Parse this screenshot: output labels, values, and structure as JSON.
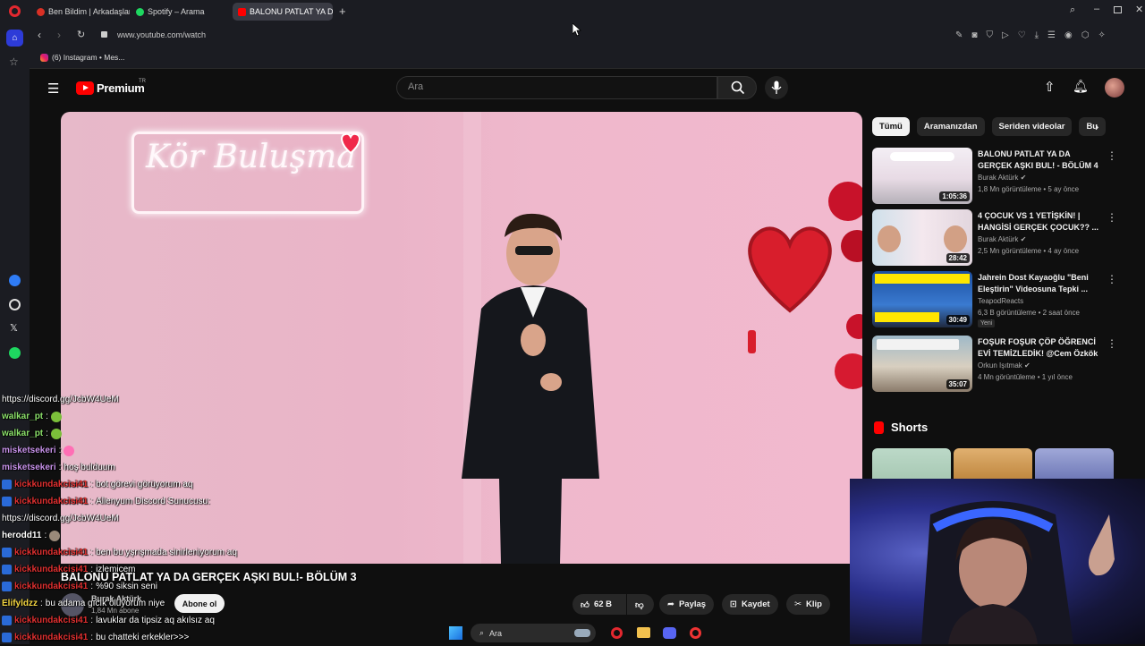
{
  "browser": {
    "tabs": [
      {
        "label": "Ben Bildim | Arkadaşlarınla",
        "color": "#d93025",
        "active": false
      },
      {
        "label": "Spotify – Arama",
        "color": "#1ed760",
        "active": false
      },
      {
        "label": "BALONU PATLAT YA DA G",
        "color": "#ff0000",
        "active": true
      }
    ],
    "url": "www.youtube.com/watch",
    "bookmark": "(6) Instagram • Mes..."
  },
  "youtube": {
    "brand": "Premium",
    "brand_region": "TR",
    "search_placeholder": "Ara"
  },
  "video": {
    "neon_sign": "Kör Buluşma",
    "title": "BALONU PATLAT YA DA GERÇEK AŞKI BUL!- BÖLÜM 3",
    "channel": "Burak Aktürk",
    "subscribers": "1,84 Mn abone",
    "subscribe_label": "Abone ol",
    "likes": "62 B",
    "share_label": "Paylaş",
    "save_label": "Kaydet",
    "clip_label": "Klip"
  },
  "chips": [
    "Tümü",
    "Aramanızdan",
    "Seriden videolar",
    "Bu"
  ],
  "recommendations": [
    {
      "title": "BALONU PATLAT YA DA GERÇEK AŞKI BUL! - BÖLÜM 4",
      "channel": "Burak Aktürk",
      "meta": "1,8 Mn görüntüleme • 5 ay önce",
      "duration": "1:05:36",
      "badge": ""
    },
    {
      "title": "4 ÇOCUK VS 1 YETİŞKİN! | HANGİSİ GERÇEK ÇOCUK?? ...",
      "channel": "Burak Aktürk",
      "meta": "2,5 Mn görüntüleme • 4 ay önce",
      "duration": "28:42",
      "badge": ""
    },
    {
      "title": "Jahrein Dost Kayaoğlu \"Beni Eleştirin\" Videosuna Tepki ...",
      "channel": "TeapodReacts",
      "meta": "6,3 B görüntüleme • 2 saat önce",
      "duration": "30:49",
      "badge": "Yeni"
    },
    {
      "title": "FOŞUR FOŞUR ÇÖP ÖĞRENCİ EVİ TEMİZLEDİK! @Cem Özkök",
      "channel": "Orkun Işıtmak",
      "meta": "4 Mn görüntüleme • 1 yıl önce",
      "duration": "35:07",
      "badge": ""
    }
  ],
  "shorts_label": "Shorts",
  "chat": [
    {
      "user": "",
      "msg": "https://discord.gg/JcbW4UeM",
      "color": "#ffffff",
      "badge": false,
      "emote": ""
    },
    {
      "user": "walkar_pt",
      "msg": "",
      "color": "#8be06a",
      "badge": false,
      "emote": "#7bbf3a"
    },
    {
      "user": "walkar_pt",
      "msg": "",
      "color": "#8be06a",
      "badge": false,
      "emote": "#7bbf3a"
    },
    {
      "user": "misketsekeri",
      "msg": "",
      "color": "#c792ea",
      "badge": false,
      "emote": "#ff6fb5"
    },
    {
      "user": "misketsekeri",
      "msg": "hoş bulduum",
      "color": "#c792ea",
      "badge": false,
      "emote": ""
    },
    {
      "user": "kickkundakcisi41",
      "msg": "bot görevi görüyorum aq",
      "color": "#e03030",
      "badge": true,
      "emote": ""
    },
    {
      "user": "kickkundakcisi41",
      "msg": "Alienyum Discord Sunucusu:",
      "color": "#e03030",
      "badge": true,
      "emote": ""
    },
    {
      "user": "",
      "msg": "https://discord.gg/JcbW4UeM",
      "color": "#ffffff",
      "badge": false,
      "emote": ""
    },
    {
      "user": "herodd11",
      "msg": "",
      "color": "#ffffff",
      "badge": false,
      "emote": "#9a8a7a"
    },
    {
      "user": "kickkundakcisi41",
      "msg": "ben bu yşrışmada sinirleniyorum aq",
      "color": "#e03030",
      "badge": true,
      "emote": ""
    },
    {
      "user": "kickkundakcisi41",
      "msg": "izlemicem",
      "color": "#e03030",
      "badge": true,
      "emote": ""
    },
    {
      "user": "kickkundakcisi41",
      "msg": "%90 siksin seni",
      "color": "#e03030",
      "badge": true,
      "emote": ""
    },
    {
      "user": "Elifyldzz",
      "msg": "bu adama gıcık oluyorum niye",
      "color": "#f5d742",
      "badge": false,
      "emote": ""
    },
    {
      "user": "kickkundakcisi41",
      "msg": "lavuklar da tipsiz aq akılsız aq",
      "color": "#e03030",
      "badge": true,
      "emote": ""
    },
    {
      "user": "kickkundakcisi41",
      "msg": "bu chatteki erkekler>>>",
      "color": "#e03030",
      "badge": true,
      "emote": ""
    }
  ],
  "taskbar": {
    "search_placeholder": "Ara"
  }
}
